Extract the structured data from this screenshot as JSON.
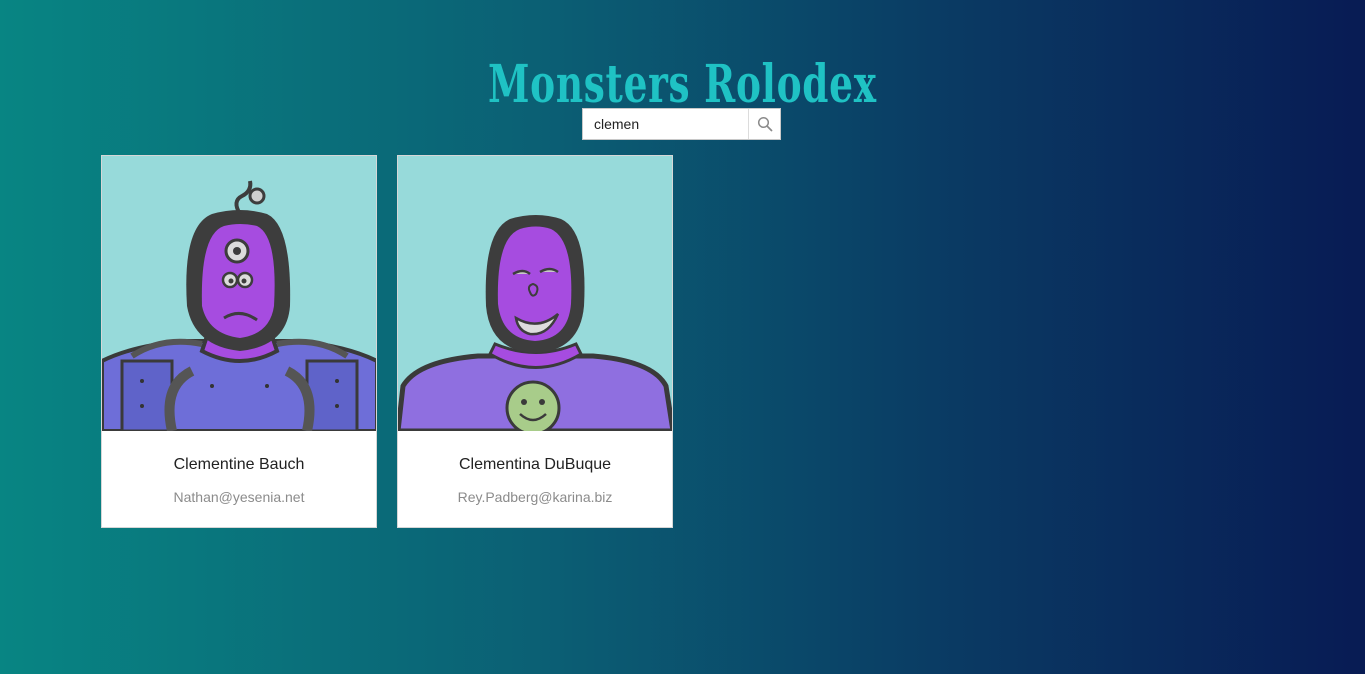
{
  "app": {
    "title": "Monsters Rolodex"
  },
  "search": {
    "value": "clemen",
    "icon": "search-icon"
  },
  "monsters": [
    {
      "name": "Clementine Bauch",
      "email": "Nathan@yesenia.net"
    },
    {
      "name": "Clementina DuBuque",
      "email": "Rey.Padberg@karina.biz"
    }
  ],
  "colors": {
    "title": "#1fc2c4",
    "card_bg": "#97dada",
    "monster_purple": "#a64ce0",
    "body_purple": "#7c6fd6"
  }
}
